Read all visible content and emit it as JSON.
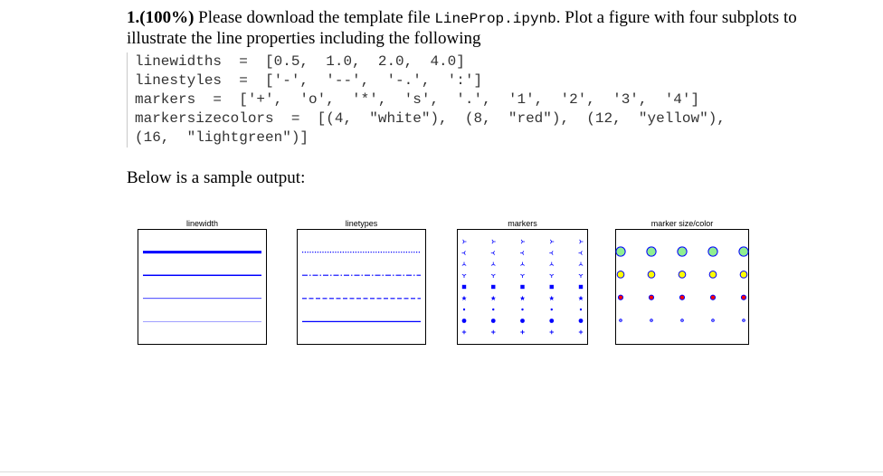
{
  "question": {
    "number": "1.",
    "weight": "(100%)",
    "text_before_file": " Please download the template file ",
    "file_name": "LineProp.ipynb",
    "text_after_file": ".  Plot a figure with four subplots to illustrate the line properties including the following"
  },
  "code_lines": [
    "linewidths  =  [0.5,  1.0,  2.0,  4.0]",
    "linestyles  =  ['-',  '--',  '-.',  ':']",
    "markers  =  ['+',  'o',  '*',  's',  '.',  '1',  '2',  '3',  '4']",
    "markersizecolors  =  [(4,  \"white\"),  (8,  \"red\"),  (12,  \"yellow\"),",
    "(16,  \"lightgreen\")]"
  ],
  "sample_label": "Below is a sample output:",
  "figure": {
    "line_color": "#0000ff",
    "marker_edge_color": "#0000ff",
    "panels": [
      {
        "title": "linewidth",
        "type": "linewidths",
        "values": [
          4.0,
          2.0,
          1.0,
          0.5
        ]
      },
      {
        "title": "linetypes",
        "type": "linestyles",
        "values": [
          ":",
          "-.",
          "--",
          "-"
        ]
      },
      {
        "title": "markers",
        "type": "markers",
        "columns": 5,
        "rows": [
          "4",
          "3",
          "2",
          "1",
          "s",
          "*",
          ".",
          "o",
          "+"
        ]
      },
      {
        "title": "marker size/color",
        "type": "markersizecolors",
        "columns": 5,
        "rows": [
          {
            "size": 16,
            "color": "#90ee90"
          },
          {
            "size": 12,
            "color": "#ffff00"
          },
          {
            "size": 8,
            "color": "#ff0000"
          },
          {
            "size": 4,
            "color": "#ffffff"
          }
        ]
      }
    ]
  }
}
